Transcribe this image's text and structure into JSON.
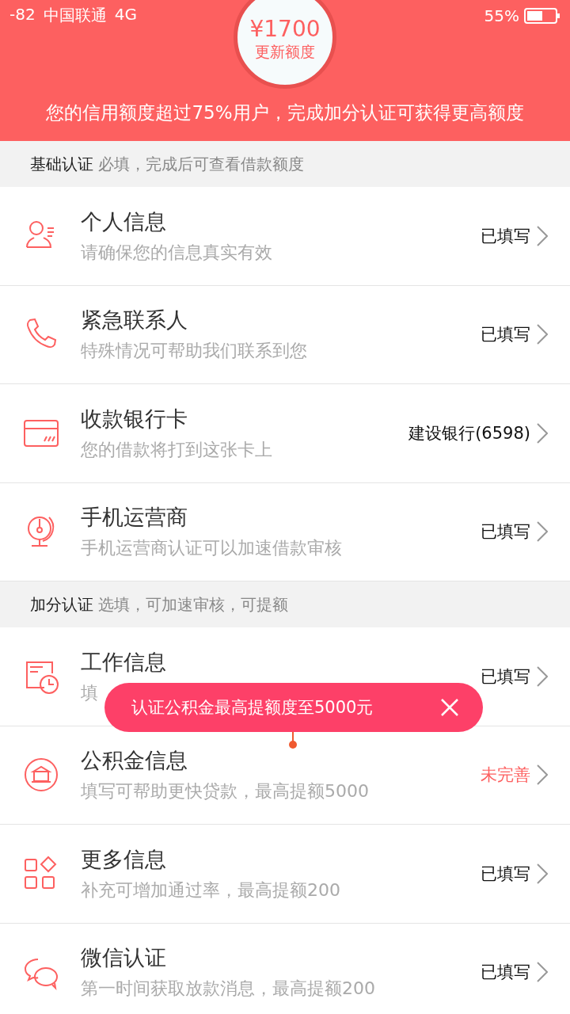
{
  "status_bar": {
    "signal": "-82",
    "carrier": "中国联通",
    "network": "4G",
    "battery": "55%"
  },
  "credit": {
    "amount": "¥1700",
    "action": "更新额度",
    "message": "您的信用额度超过75%用户，完成加分认证可获得更高额度"
  },
  "sections": [
    {
      "title": "基础认证",
      "note": "必填，完成后可查看借款额度",
      "items": [
        {
          "kind": "person",
          "title": "个人信息",
          "subtitle": "请确保您的信息真实有效",
          "status": "已填写",
          "complete": true
        },
        {
          "kind": "phone",
          "title": "紧急联系人",
          "subtitle": "特殊情况可帮助我们联系到您",
          "status": "已填写",
          "complete": true
        },
        {
          "kind": "card",
          "title": "收款银行卡",
          "subtitle": "您的借款将打到这张卡上",
          "status": "建设银行(6598)",
          "complete": true
        },
        {
          "kind": "globe",
          "title": "手机运营商",
          "subtitle": "手机运营商认证可以加速借款审核",
          "status": "已填写",
          "complete": true
        }
      ]
    },
    {
      "title": "加分认证",
      "note": "选填，可加速审核，可提额",
      "items": [
        {
          "kind": "clock",
          "title": "工作信息",
          "subtitle": "填",
          "status": "已填写",
          "complete": true
        },
        {
          "kind": "fund",
          "title": "公积金信息",
          "subtitle": "填写可帮助更快贷款，最高提额5000",
          "status": "未完善",
          "complete": false
        },
        {
          "kind": "apps",
          "title": "更多信息",
          "subtitle": "补充可增加通过率，最高提额200",
          "status": "已填写",
          "complete": true
        },
        {
          "kind": "chat",
          "title": "微信认证",
          "subtitle": "第一时间获取放款消息，最高提额200",
          "status": "已填写",
          "complete": true
        }
      ]
    }
  ],
  "tooltip": {
    "text": "认证公积金最高提额度至5000元"
  }
}
